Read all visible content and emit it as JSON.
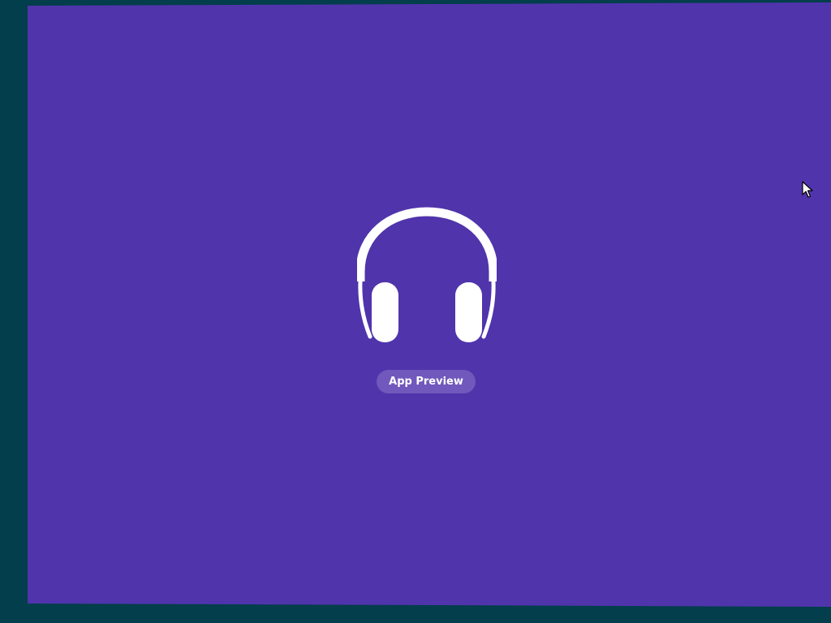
{
  "colors": {
    "desktop_bg": "#023e4b",
    "splash_bg": "#5034ab",
    "badge_bg": "#7058bc",
    "icon_fill": "#ffffff"
  },
  "splash": {
    "icon": "headphones-icon",
    "badge_label": "App Preview"
  },
  "cursor": {
    "icon": "mouse-pointer-icon"
  }
}
